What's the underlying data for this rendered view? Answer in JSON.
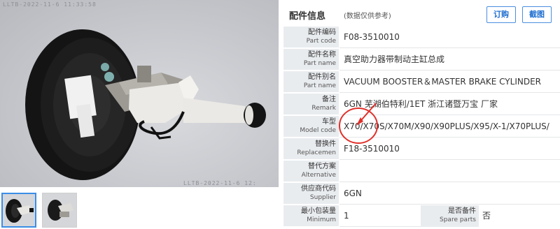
{
  "photo": {
    "stamp_top": "LLTB-2022-11-6 11:33:58",
    "stamp_bottom": "LLTB-2022-11-6 12:"
  },
  "info": {
    "title": "配件信息",
    "note": "(数据仅供参考)",
    "order_button": "订购",
    "screenshot_button": "截图",
    "rows": [
      {
        "zh": "配件编码",
        "en": "Part code",
        "value": "F08-3510010"
      },
      {
        "zh": "配件名称",
        "en": "Part name",
        "value": "真空助力器带制动主缸总成"
      },
      {
        "zh": "配件别名",
        "en": "Part name",
        "value": "VACUUM BOOSTER＆MASTER BRAKE CYLINDER"
      },
      {
        "zh": "备注",
        "en": "Remark",
        "value": "6GN 芜湖伯特利/1ET 浙江诸暨万宝 厂家"
      },
      {
        "zh": "车型",
        "en": "Model code",
        "value": "X70/X70S/X70M/X90/X90PLUS/X95/X-1/X70PLUS/"
      },
      {
        "zh": "替换件",
        "en": "Replacemen",
        "value": "F18-3510010"
      },
      {
        "zh": "替代方案",
        "en": "Alternative",
        "value": ""
      },
      {
        "zh": "供应商代码",
        "en": "Supplier",
        "value": "6GN"
      }
    ],
    "minimum": {
      "zh": "最小包装量",
      "en": "Minimum",
      "value": "1"
    },
    "spare": {
      "zh": "是否备件",
      "en": "Spare parts",
      "value": "否"
    }
  },
  "colors": {
    "accent": "#1e6fd0",
    "label_bg": "#e9ecef",
    "annotation": "#e0302a"
  }
}
